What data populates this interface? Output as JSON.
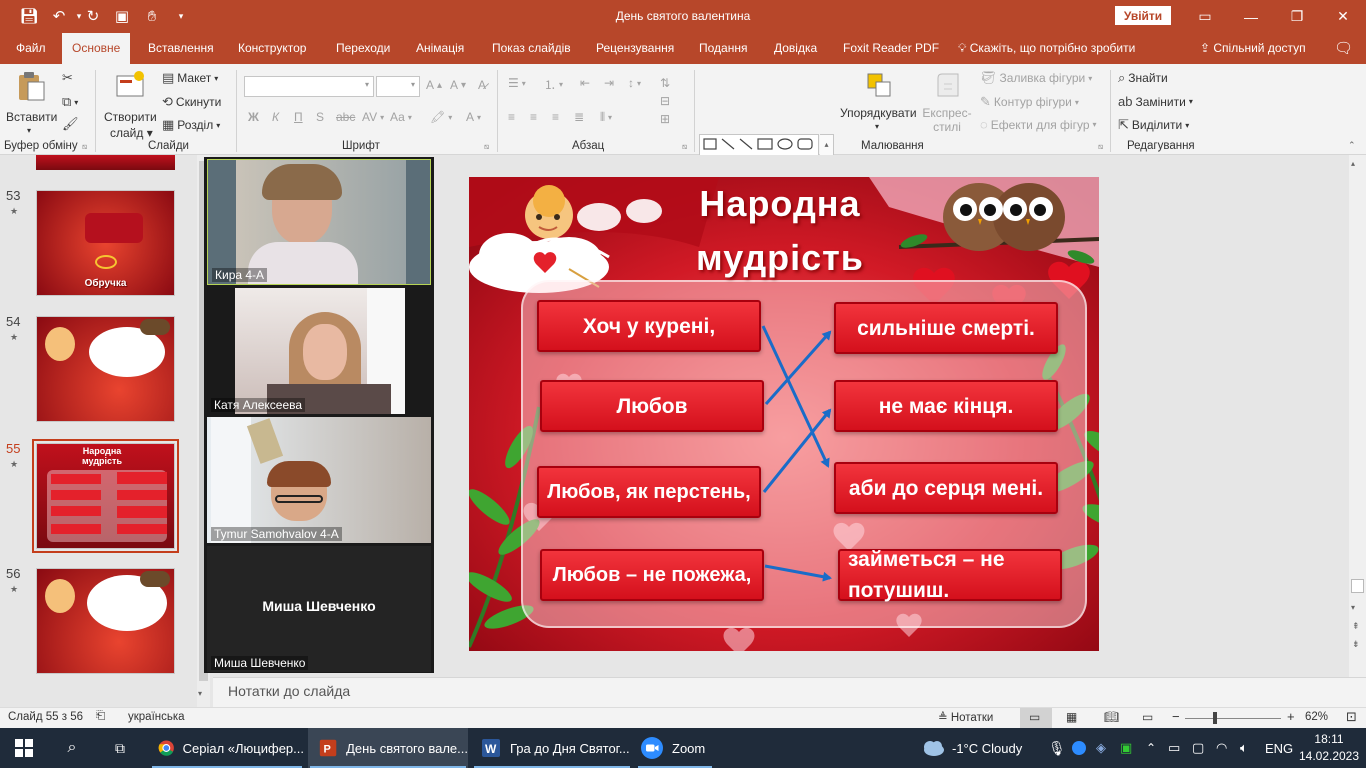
{
  "window": {
    "title": "День святого валентина",
    "sign_in": "Увійти"
  },
  "ribbon_tabs": [
    "Файл",
    "Основне",
    "Вставлення",
    "Конструктор",
    "Переходи",
    "Анімація",
    "Показ слайдів",
    "Рецензування",
    "Подання",
    "Довідка",
    "Foxit Reader PDF"
  ],
  "active_tab": "Основне",
  "tell_me": "Скажіть, що потрібно зробити",
  "share": "Спільний доступ",
  "ribbon": {
    "paste": "Вставити",
    "new_slide": "Створити слайд",
    "layout": "Макет",
    "reset": "Скинути",
    "section": "Розділ",
    "arrange": "Упорядкувати",
    "quick_styles": "Експрес-стилі",
    "shape_fill": "Заливка фігури",
    "shape_outline": "Контур фігури",
    "shape_effects": "Ефекти для фігур",
    "find": "Знайти",
    "replace": "Замінити",
    "select": "Виділити",
    "font_buttons": [
      "Ж",
      "К",
      "П",
      "S",
      "Аа"
    ],
    "groups": [
      "Буфер обміну",
      "Слайди",
      "Шрифт",
      "Абзац",
      "Малювання",
      "Редагування"
    ]
  },
  "thumbnails": [
    {
      "num": "53",
      "star": "★",
      "text": "Обручка"
    },
    {
      "num": "54",
      "star": "★",
      "text": ""
    },
    {
      "num": "55",
      "star": "★",
      "text": "Народна мудрість",
      "selected": true
    },
    {
      "num": "56",
      "star": "★",
      "text": ""
    }
  ],
  "zoom_participants": [
    {
      "name": "Кира 4-А",
      "active_speaker": true
    },
    {
      "name": "Катя Алексеева"
    },
    {
      "name": "Tymur Samohvalov 4-A"
    },
    {
      "name": "Миша Шевченко",
      "no_video_label": "Миша Шевченко"
    }
  ],
  "slide": {
    "title_line1": "Народна",
    "title_line2": "мудрість",
    "left_cards": [
      "Хоч у курені,",
      "Любов",
      "Любов, як перстень,",
      "Любов – не пожежа,"
    ],
    "right_cards": [
      "сильніше смерті.",
      "не має кінця.",
      "аби до серця мені.",
      "займеться – не потушиш."
    ]
  },
  "notes_placeholder": "Нотатки до слайда",
  "status": {
    "slide_counter": "Слайд 55 з 56",
    "language": "українська",
    "notes_button": "Нотатки",
    "zoom_level": "62%",
    "zoom_fraction": 0.62
  },
  "taskbar": {
    "apps": [
      {
        "label": "Серіал «Люцифер...",
        "icon": "chrome-icon"
      },
      {
        "label": "День святого вале...",
        "icon": "powerpoint-icon",
        "active": true
      },
      {
        "label": "Гра до Дня Святог...",
        "icon": "word-icon"
      },
      {
        "label": "Zoom",
        "icon": "zoom-icon"
      }
    ],
    "weather": "-1°C  Cloudy",
    "language": "ENG",
    "time": "18:11",
    "date": "14.02.2023"
  },
  "colors": {
    "accent": "#b7472a",
    "taskbar": "#1f2b3a",
    "card_red": "#e4212b",
    "arrow_blue": "#1a6cc8"
  }
}
